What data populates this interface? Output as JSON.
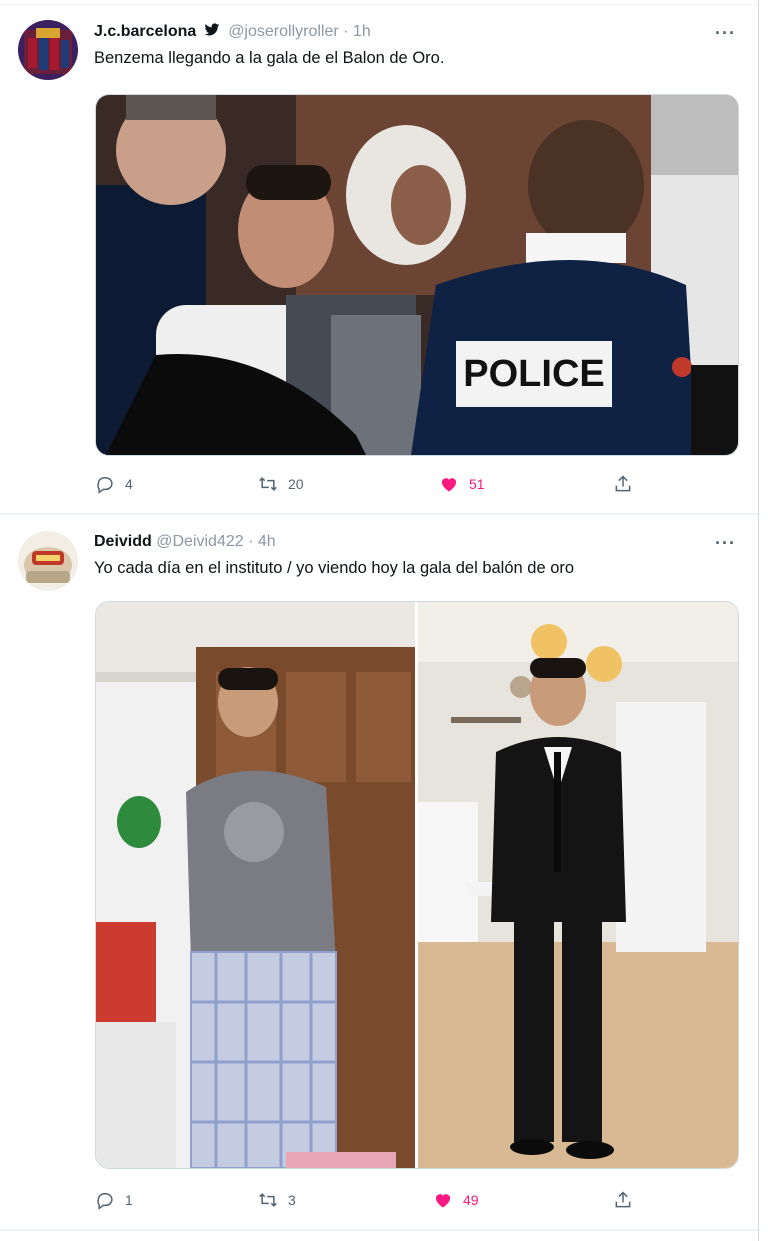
{
  "tweets": [
    {
      "display_name": "J.c.barcelona",
      "handle": "@joserollyroller",
      "dot": "·",
      "time": "1h",
      "text": "Benzema llegando a  la gala de el Balon de Oro.",
      "more": "···",
      "media_text": "POLICE",
      "replies": "4",
      "retweets": "20",
      "likes": "51"
    },
    {
      "display_name": "Deividd",
      "handle": "@Deivid422",
      "dot": "·",
      "time": "4h",
      "text": "Yo cada día en el instituto / yo viendo hoy la gala del balón de oro",
      "more": "···",
      "replies": "1",
      "retweets": "3",
      "likes": "49"
    }
  ],
  "colors": {
    "like": "#f91880",
    "muted": "#8b98a5",
    "border": "#cfd9de"
  },
  "icons": [
    "verified-bird-icon",
    "more-icon",
    "reply-icon",
    "retweet-icon",
    "heart-icon",
    "share-icon"
  ]
}
